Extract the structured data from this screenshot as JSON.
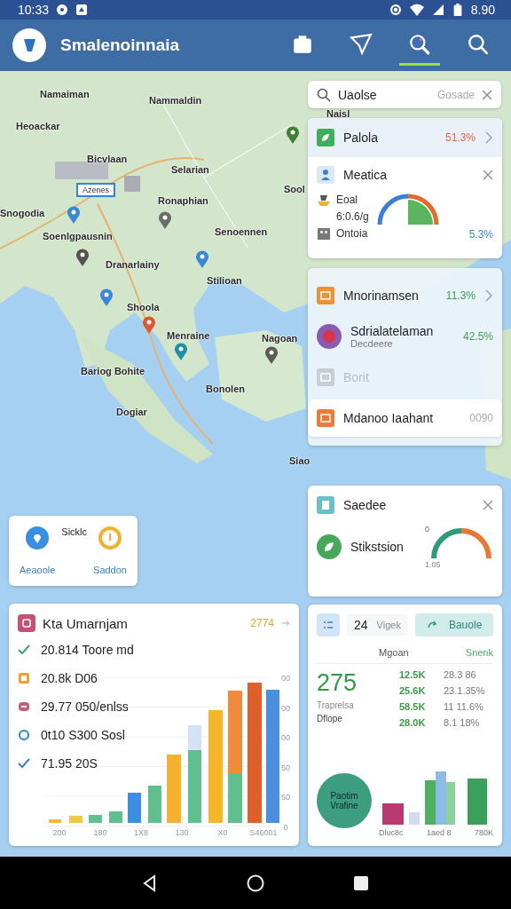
{
  "status_bar": {
    "time": "10:33",
    "battery": "8.90"
  },
  "app_bar": {
    "title": "Smalenoinnaia",
    "actions": [
      {
        "selected": false
      },
      {
        "selected": false
      },
      {
        "selected": true
      },
      {
        "selected": false
      }
    ]
  },
  "map": {
    "labels": [
      {
        "kind": "place",
        "text": "Namaiman"
      },
      {
        "kind": "place",
        "text": "Nammaldin"
      },
      {
        "kind": "place",
        "text": "Heoackar"
      },
      {
        "kind": "place",
        "text": "Bicvlaan"
      },
      {
        "kind": "place",
        "text": "Selarian"
      },
      {
        "kind": "place",
        "text": "Sool"
      },
      {
        "kind": "box",
        "text": "Azenes"
      },
      {
        "kind": "place",
        "text": "Ronaphian"
      },
      {
        "kind": "place",
        "text": "Snogodia"
      },
      {
        "kind": "place",
        "text": "Senoennen"
      },
      {
        "kind": "place",
        "text": "Soenlgpausnin"
      },
      {
        "kind": "place",
        "text": "Dranarlainy"
      },
      {
        "kind": "place",
        "text": "Stilioan"
      },
      {
        "kind": "place",
        "text": "Shoola"
      },
      {
        "kind": "place",
        "text": "Menraine"
      },
      {
        "kind": "place",
        "text": "Nagoan"
      },
      {
        "kind": "place",
        "text": "Bariog Bohite"
      },
      {
        "kind": "place",
        "text": "Bonolen"
      },
      {
        "kind": "place",
        "text": "Dogiar"
      },
      {
        "kind": "place",
        "text": "Siao"
      },
      {
        "kind": "place",
        "text": "Naisl"
      }
    ],
    "pins": [
      {
        "color": "#3a86d8"
      },
      {
        "color": "#3a86d8"
      },
      {
        "color": "#3a86d8"
      },
      {
        "color": "#e0562e"
      },
      {
        "color": "#1f8fa8"
      },
      {
        "color": "#6b6b6b"
      },
      {
        "color": "#5e5a55"
      },
      {
        "color": "#3f7f3a"
      },
      {
        "color": "#55524f"
      }
    ]
  },
  "search": {
    "value": "Uaolse",
    "hint": "Gosade"
  },
  "card_a": {
    "row": {
      "title": "Palola",
      "value": "51.3%"
    },
    "section": {
      "title": "Meatica",
      "lines": [
        "Eoal",
        "6:0.6/g",
        "Ontoia"
      ],
      "value": "5.3%"
    }
  },
  "card_b": {
    "items": [
      {
        "kind": "row",
        "title": "Mnorinamsen",
        "value": "11.3%",
        "color": "#f0913a",
        "disabled": false,
        "selected": false
      },
      {
        "kind": "avatar",
        "title": "Sdrialatelaman",
        "subtitle": "Decdeere",
        "value": "42.5%",
        "color": "#8b5bb0",
        "disabled": false,
        "selected": false
      },
      {
        "kind": "row",
        "title": "Borit",
        "color": "#c9ced4",
        "disabled": true,
        "selected": false
      },
      {
        "kind": "row",
        "title": "Mdanoo Iaahant",
        "value": "0090",
        "color": "#ec7a36",
        "disabled": false,
        "selected": true
      }
    ]
  },
  "card_c": {
    "title": "Saedee",
    "item": "Stikstsion",
    "gauge_min": "0",
    "gauge_max": "1.05"
  },
  "legend": {
    "title": "Sicklc",
    "items": [
      {
        "label": "Aeaoole",
        "color": "#3b8fe0"
      },
      {
        "label": "Saddon",
        "color": "#f0b030"
      }
    ]
  },
  "stats": {
    "title": "Kta Umarnjam",
    "badge": "2774",
    "rows": [
      {
        "kind": "check",
        "color": "#3aa66a",
        "text": "20.814 Toore md"
      },
      {
        "kind": "square",
        "color": "#f0a030",
        "text": "20.8k D06"
      },
      {
        "kind": "badge",
        "color": "#c0607a",
        "text": "29.77 050/enlss"
      },
      {
        "kind": "ring",
        "color": "#2f8fbf",
        "text": "0t10 S300 Sosl"
      },
      {
        "kind": "check",
        "color": "#3a7fd8",
        "text": "71.95 20S"
      }
    ],
    "y_labels": [
      "00",
      "00",
      "00",
      "50",
      "50",
      "0"
    ],
    "x_labels": [
      "200",
      "180",
      "1X8",
      "130",
      "X0",
      "S46001"
    ]
  },
  "summary": {
    "count": "24",
    "unit": "Vigek",
    "button": "Bauole",
    "headers": [
      "Mgoan",
      "Snenk"
    ],
    "total": "275",
    "captions": [
      "Traprelsa",
      "Dflope"
    ],
    "rows": [
      [
        "12.5K",
        "28.3 86"
      ],
      [
        "25.6K",
        "23.1.35%"
      ],
      [
        "58.5K",
        "11 11.6%"
      ],
      [
        "28.0K",
        "8.1 18%"
      ]
    ],
    "circle": "Paotim Vrafine",
    "x_labels": [
      "Dluc8c",
      "1aed 8",
      "780K"
    ]
  }
}
